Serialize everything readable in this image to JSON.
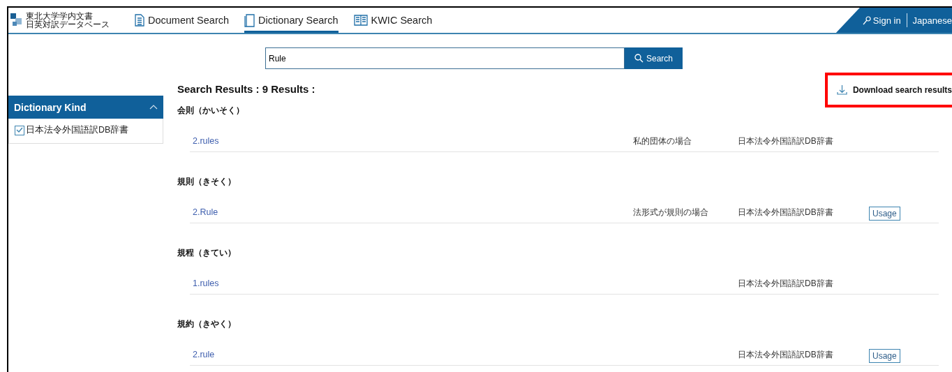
{
  "logo": {
    "line_1": "東北大学学内文書",
    "line_2": "日英対訳データベース"
  },
  "nav": [
    {
      "label": "Document Search",
      "kind": "document",
      "selected": false
    },
    {
      "label": "Dictionary Search",
      "kind": "dictionary",
      "selected": true
    },
    {
      "label": "KWIC Search",
      "kind": "kwic",
      "selected": false
    }
  ],
  "account": {
    "sign_in": "Sign in",
    "language": "Japanese"
  },
  "search": {
    "value": "Rule",
    "button": "Search"
  },
  "sidebar": {
    "title": "Dictionary Kind",
    "expanded": true,
    "items": [
      {
        "label": "日本法令外国語訳DB辞書",
        "checked": true
      }
    ]
  },
  "results": {
    "title": "Search Results : 9 Results :",
    "download": "Download search results",
    "highlighted": true,
    "groups": [
      {
        "heading": "会則（かいそく）",
        "rows": [
          {
            "term": "2.rules",
            "note": "私的団体の場合",
            "dictionary": "日本法令外国語訳DB辞書",
            "usage": null
          }
        ]
      },
      {
        "heading": "規則（きそく）",
        "rows": [
          {
            "term": "2.Rule",
            "note": "法形式が規則の場合",
            "dictionary": "日本法令外国語訳DB辞書",
            "usage": "Usage"
          }
        ]
      },
      {
        "heading": "規程（きてい）",
        "rows": [
          {
            "term": "1.rules",
            "note": null,
            "dictionary": "日本法令外国語訳DB辞書",
            "usage": null
          }
        ]
      },
      {
        "heading": "規約（きやく）",
        "rows": [
          {
            "term": "2.rule",
            "note": null,
            "dictionary": "日本法令外国語訳DB辞書",
            "usage": "Usage"
          }
        ]
      }
    ]
  }
}
